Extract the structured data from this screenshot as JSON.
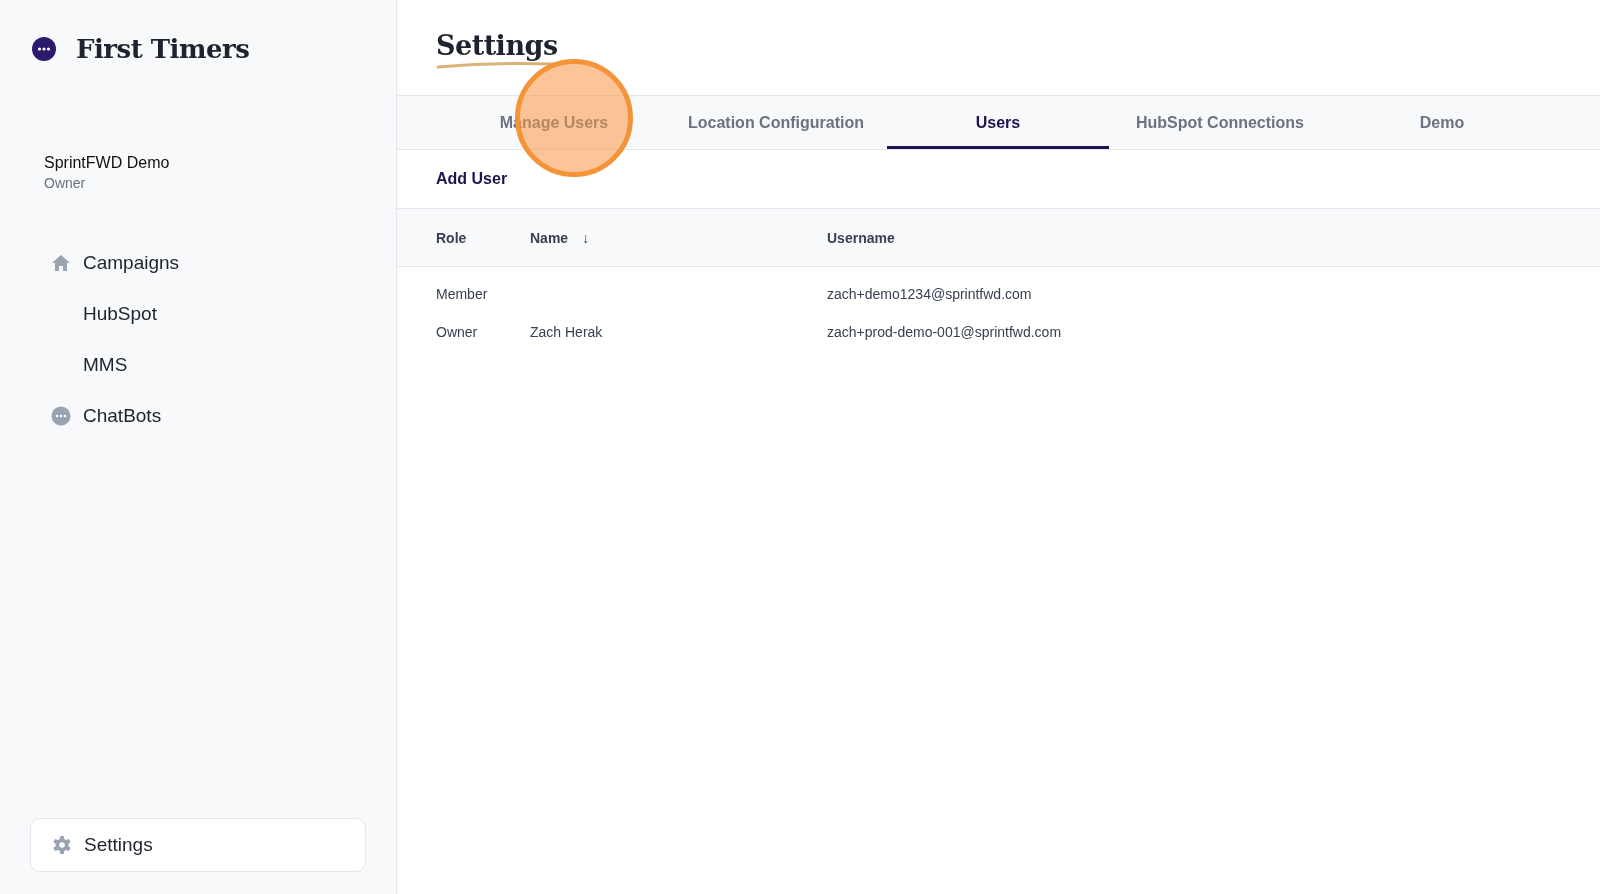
{
  "sidebar": {
    "brand": "First Timers",
    "account": {
      "name": "SprintFWD Demo",
      "role": "Owner"
    },
    "items": [
      {
        "label": "Campaigns",
        "kind": "home",
        "selected": false,
        "children": [
          {
            "label": "HubSpot",
            "selected": false
          },
          {
            "label": "MMS",
            "selected": false
          }
        ]
      },
      {
        "label": "ChatBots",
        "kind": "chat",
        "selected": false
      }
    ],
    "footer_item": {
      "label": "Settings",
      "kind": "gear",
      "selected": true
    }
  },
  "main": {
    "title": "Settings",
    "tabs": [
      {
        "label": "Manage Users",
        "selected": false
      },
      {
        "label": "Location Configuration",
        "selected": false
      },
      {
        "label": "Users",
        "selected": true
      },
      {
        "label": "HubSpot Connections",
        "selected": false
      },
      {
        "label": "Demo",
        "selected": false
      }
    ],
    "action": "Add User",
    "table": {
      "columns": [
        {
          "label": "Role"
        },
        {
          "label": "Name",
          "sort_indicator": "↓"
        },
        {
          "label": "Username"
        }
      ],
      "rows": [
        [
          "Member",
          "",
          "zach+demo1234@sprintfwd.com"
        ],
        [
          "Owner",
          "Zach Herak",
          "zach+prod-demo-001@sprintfwd.com"
        ]
      ]
    }
  }
}
